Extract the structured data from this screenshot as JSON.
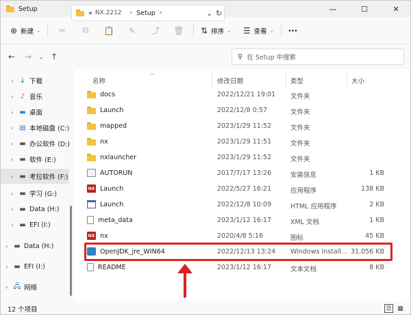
{
  "window": {
    "title": "Setup",
    "controls": [
      "—",
      "☐",
      "✕"
    ]
  },
  "command_bar": {
    "new_label": "新建",
    "sort_label": "排序",
    "view_label": "查看",
    "more": "···"
  },
  "address": {
    "overflow": "«",
    "crumbs": [
      "NX.2212",
      "Setup"
    ],
    "search_placeholder": "在 Setup 中搜索"
  },
  "sidebar": {
    "items": [
      {
        "label": "下载",
        "icon": "download-icon"
      },
      {
        "label": "音乐",
        "icon": "music-icon"
      },
      {
        "label": "桌面",
        "icon": "desktop-icon"
      },
      {
        "label": "本地磁盘 (C:)",
        "icon": "drive-icon"
      },
      {
        "label": "办公软件 (D:)",
        "icon": "drive-icon"
      },
      {
        "label": "软件 (E:)",
        "icon": "drive-icon"
      },
      {
        "label": "考拉软件 (F:)",
        "icon": "drive-icon"
      },
      {
        "label": "学习 (G:)",
        "icon": "drive-icon"
      },
      {
        "label": "Data (H:)",
        "icon": "drive-icon"
      },
      {
        "label": "EFI (I:)",
        "icon": "drive-icon"
      },
      {
        "label": "Data (H:)",
        "icon": "drive-icon"
      },
      {
        "label": "EFI (I:)",
        "icon": "drive-icon"
      },
      {
        "label": "网络",
        "icon": "network-icon"
      }
    ]
  },
  "columns": {
    "name": "名称",
    "modified": "修改日期",
    "type": "类型",
    "size": "大小"
  },
  "files": [
    {
      "name": "docs",
      "modified": "2022/12/21 19:01",
      "type": "文件夹",
      "size": "",
      "kind": "folder"
    },
    {
      "name": "Launch",
      "modified": "2022/12/8 0:57",
      "type": "文件夹",
      "size": "",
      "kind": "folder"
    },
    {
      "name": "mapped",
      "modified": "2023/1/29 11:52",
      "type": "文件夹",
      "size": "",
      "kind": "folder"
    },
    {
      "name": "nx",
      "modified": "2023/1/29 11:51",
      "type": "文件夹",
      "size": "",
      "kind": "folder"
    },
    {
      "name": "nxlauncher",
      "modified": "2023/1/29 11:52",
      "type": "文件夹",
      "size": "",
      "kind": "folder"
    },
    {
      "name": "AUTORUN",
      "modified": "2017/7/17 13:26",
      "type": "安装信息",
      "size": "1 KB",
      "kind": "inf"
    },
    {
      "name": "Launch",
      "modified": "2022/5/27 16:21",
      "type": "应用程序",
      "size": "138 KB",
      "kind": "nx"
    },
    {
      "name": "Launch",
      "modified": "2022/12/8 10:09",
      "type": "HTML 应用程序",
      "size": "2 KB",
      "kind": "win"
    },
    {
      "name": "meta_data",
      "modified": "2023/1/12 16:17",
      "type": "XML 文档",
      "size": "1 KB",
      "kind": "doc"
    },
    {
      "name": "nx",
      "modified": "2020/4/8 5:16",
      "type": "图标",
      "size": "45 KB",
      "kind": "nx"
    },
    {
      "name": "OpenJDK_jre_WIN64",
      "modified": "2022/12/13 13:24",
      "type": "Windows Install...",
      "size": "31,056 KB",
      "kind": "msi"
    },
    {
      "name": "README",
      "modified": "2023/1/12 16:17",
      "type": "文本文档",
      "size": "8 KB",
      "kind": "doc"
    }
  ],
  "status": {
    "count": "12 个项目"
  }
}
